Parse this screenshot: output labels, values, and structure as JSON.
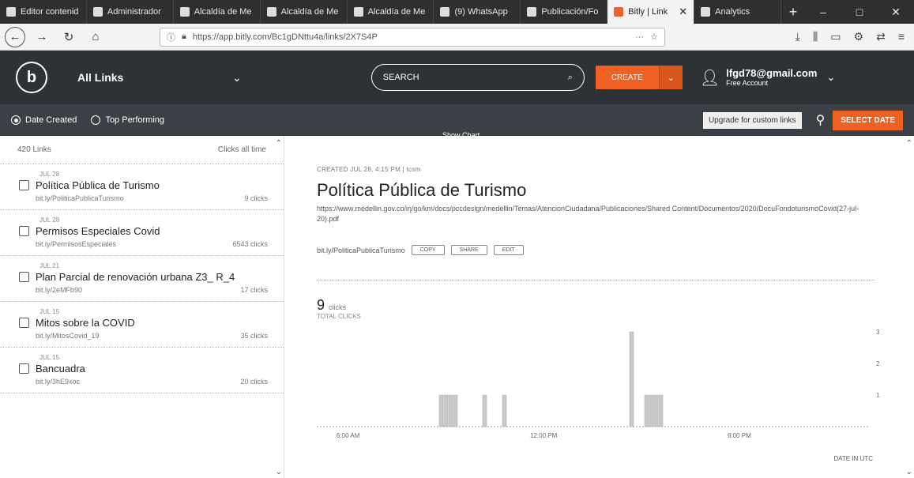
{
  "browser": {
    "tabs": [
      {
        "label": "Editor contenid",
        "active": false
      },
      {
        "label": "Administrador",
        "active": false
      },
      {
        "label": "Alcaldía de Me",
        "active": false
      },
      {
        "label": "Alcaldía de Me",
        "active": false
      },
      {
        "label": "Alcaldía de Me",
        "active": false
      },
      {
        "label": "(9) WhatsApp",
        "active": false
      },
      {
        "label": "Publicación/Fo",
        "active": false
      },
      {
        "label": "Bitly | Link",
        "active": true
      },
      {
        "label": "Analytics",
        "active": false
      }
    ],
    "url": "https://app.bitly.com/Bc1gDNttu4a/links/2X7S4P"
  },
  "header": {
    "section": "All Links",
    "search_placeholder": "SEARCH",
    "create_label": "CREATE",
    "account_email": "lfgd78@gmail.com",
    "account_plan": "Free Account"
  },
  "filters": {
    "date_created": "Date Created",
    "top_performing": "Top Performing",
    "upgrade": "Upgrade for custom links",
    "select_date": "SELECT DATE",
    "show_chart": "Show Chart"
  },
  "sidebar": {
    "count": "420 Links",
    "clicks_all_time": "Clicks all time",
    "items": [
      {
        "date": "JUL 28",
        "title": "Política Pública de Turismo",
        "short": "bit.ly/PoliticaPublicaTurismo",
        "clicks": "9",
        "unit": "clicks"
      },
      {
        "date": "JUL 28",
        "title": "Permisos Especiales Covid",
        "short": "bit.ly/PermisosEspeciales",
        "clicks": "6543",
        "unit": "clicks"
      },
      {
        "date": "JUL 21",
        "title": "Plan Parcial de renovación urbana Z3_ R_4",
        "short": "bit.ly/2eMFb90",
        "clicks": "17",
        "unit": "clicks"
      },
      {
        "date": "JUL 15",
        "title": "Mitos sobre la COVID",
        "short": "bit.ly/MitosCovid_19",
        "clicks": "35",
        "unit": "clicks"
      },
      {
        "date": "JUL 15",
        "title": "Bancuadra",
        "short": "bit.ly/3hE9xoc",
        "clicks": "20",
        "unit": "clicks"
      }
    ]
  },
  "detail": {
    "created": "CREATED JUL 28, 4:15 PM | tcsm",
    "title": "Política Pública de Turismo",
    "long_url": "https://www.medellin.gov.co/irj/go/km/docs/pccdesign/medellin/Temas/AtencionCiudadana/Publicaciones/Shared Content/Documentos/2020/DocuFondoturismoCovid(27-jul-20).pdf",
    "short_url": "bit.ly/PoliticaPublicaTurismo",
    "btn_copy": "COPY",
    "btn_share": "SHARE",
    "btn_edit": "EDIT",
    "clicks": "9",
    "clicks_unit": "clicks",
    "total_clicks_label": "TOTAL CLICKS",
    "date_in_utc": "DATE IN UTC"
  },
  "chart_data": {
    "type": "bar",
    "x": [
      "6:00 AM",
      "12:00 PM",
      "6:00 PM"
    ],
    "values": [
      1,
      1,
      1,
      1,
      1,
      1,
      3,
      1,
      1,
      1,
      1
    ],
    "ylim": [
      0,
      3
    ],
    "yticks": [
      1,
      2,
      3
    ],
    "xlabel": "DATE IN UTC",
    "ylabel": "",
    "color": "#c9c9c9"
  },
  "colors": {
    "header_bg": "#2c3236",
    "accent": "#ee6123",
    "filter_bg": "#3a4045"
  }
}
